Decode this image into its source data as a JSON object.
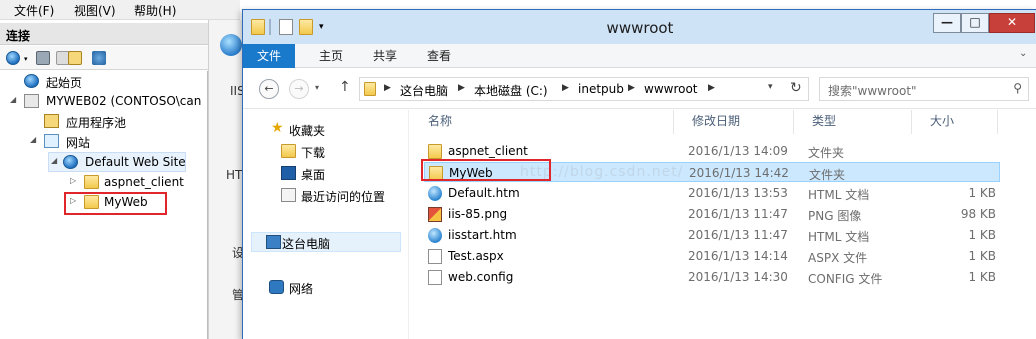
{
  "iis": {
    "menu": [
      "文件(F)",
      "视图(V)",
      "帮助(H)"
    ],
    "connections_title": "连接",
    "tree": {
      "start_page": "起始页",
      "server": "MYWEB02 (CONTOSO\\can",
      "app_pools": "应用程序池",
      "sites": "网站",
      "default_site": "Default Web Site",
      "aspnet_client": "aspnet_client",
      "myweb": "MyWeb"
    },
    "fragments": [
      "IIS",
      "HT",
      "设",
      "管"
    ]
  },
  "explorer": {
    "title": "wwwroot",
    "window_buttons": [
      "—",
      "□",
      "✕"
    ],
    "ribbon_tabs": [
      "文件",
      "主页",
      "共享",
      "查看"
    ],
    "breadcrumb": [
      "这台电脑",
      "本地磁盘 (C:)",
      "inetpub",
      "wwwroot"
    ],
    "search_placeholder": "搜索\"wwwroot\"",
    "nav": {
      "favorites": "收藏夹",
      "downloads": "下载",
      "desktop": "桌面",
      "recent": "最近访问的位置",
      "this_pc": "这台电脑",
      "network": "网络"
    },
    "columns": [
      "名称",
      "修改日期",
      "类型",
      "大小"
    ],
    "files": [
      {
        "name": "aspnet_client",
        "date": "2016/1/13 14:09",
        "type": "文件夹",
        "size": "",
        "icon": "folder-icon"
      },
      {
        "name": "MyWeb",
        "date": "2016/1/13 14:42",
        "type": "文件夹",
        "size": "",
        "icon": "folder-icon"
      },
      {
        "name": "Default.htm",
        "date": "2016/1/13 13:53",
        "type": "HTML 文档",
        "size": "1 KB",
        "icon": "html-file-icon"
      },
      {
        "name": "iis-85.png",
        "date": "2016/1/13 11:47",
        "type": "PNG 图像",
        "size": "98 KB",
        "icon": "png-file-icon"
      },
      {
        "name": "iisstart.htm",
        "date": "2016/1/13 11:47",
        "type": "HTML 文档",
        "size": "1 KB",
        "icon": "html-file-icon"
      },
      {
        "name": "Test.aspx",
        "date": "2016/1/13 14:14",
        "type": "ASPX 文件",
        "size": "1 KB",
        "icon": "aspx-file-icon"
      },
      {
        "name": "web.config",
        "date": "2016/1/13 14:30",
        "type": "CONFIG 文件",
        "size": "1 KB",
        "icon": "config-file-icon"
      }
    ],
    "watermark": "http://blog.csdn.net/"
  },
  "colors": {
    "highlight_red": "#e0262a",
    "selection_blue": "#cce8ff",
    "ribbon_file_blue": "#1979ca",
    "titlebar": "#cfe3f7"
  }
}
